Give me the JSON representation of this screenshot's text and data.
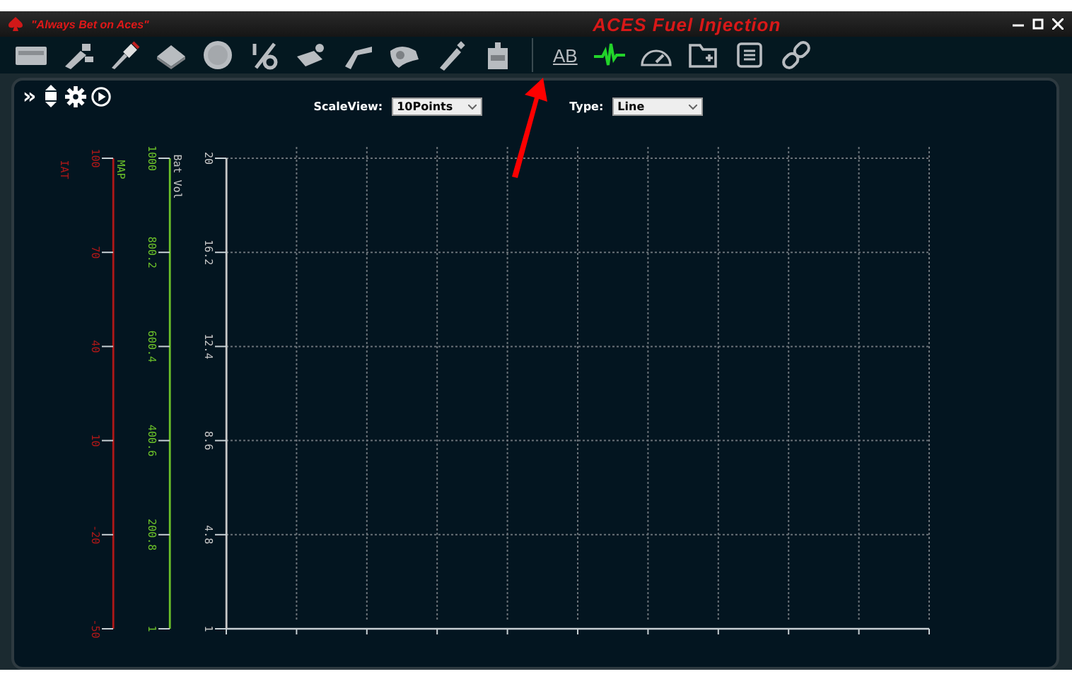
{
  "window": {
    "tagline": "\"Always Bet on Aces\"",
    "title": "ACES Fuel Injection"
  },
  "toolbar": {
    "left_tools": [
      {
        "selected": false
      },
      {
        "selected": false
      },
      {
        "selected": false
      },
      {
        "selected": false
      },
      {
        "selected": false
      },
      {
        "selected": false
      },
      {
        "selected": false
      },
      {
        "selected": false
      },
      {
        "selected": false
      },
      {
        "selected": false
      },
      {
        "selected": false
      }
    ],
    "right_tools": [
      {
        "label": "AB",
        "selected": false
      },
      {
        "selected": true
      },
      {
        "selected": false
      },
      {
        "selected": false
      },
      {
        "selected": false
      },
      {
        "selected": false
      }
    ]
  },
  "panel": {
    "expand": "»",
    "scale_view": {
      "label": "ScaleView:",
      "value": "10Points"
    },
    "type": {
      "label": "Type:",
      "value": "Line"
    },
    "axes": [
      {
        "name": "IAT",
        "color": "#b01818",
        "ticks": [
          "100",
          "70",
          "40",
          "10",
          "-20",
          "-50"
        ]
      },
      {
        "name": "MAP",
        "color": "#6cc22a",
        "ticks": [
          "1000",
          "800.2",
          "600.4",
          "400.6",
          "200.8",
          "1"
        ]
      },
      {
        "name": "Bat Vol",
        "color": "#c8c8c8",
        "ticks": [
          "20",
          "16.2",
          "12.4",
          "8.6",
          "4.8",
          "1"
        ]
      }
    ]
  }
}
